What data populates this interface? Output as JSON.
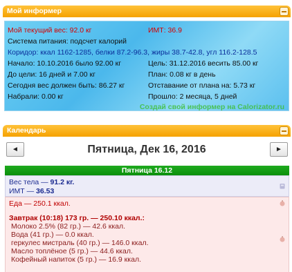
{
  "informer": {
    "header": "Мой информер",
    "rows": {
      "current_weight": "Мой текущий вес: 92.0 кг",
      "bmi": "ИМТ: 36.9",
      "system": "Система питания: подсчет калорий",
      "corridor": "Коридор: ккал 1162-1285, белки 87.2-96.3, жиры 38.7-42.8, угл 116.2-128.5",
      "start": "Начало: 10.10.2016 было 92.00 кг",
      "goal": "Цель: 31.12.2016 весить 85.00 кг",
      "to_goal": "До цели: 16 дней и 7.00 кг",
      "plan": "План: 0.08 кг в день",
      "should_weigh": "Сегодня вес должен быть: 86.27 кг",
      "lag": "Отставание от плана на: 5.73 кг",
      "gained": "Набрали: 0.00 кг",
      "elapsed": "Прошло: 2 месяца, 5 дней"
    },
    "watermark": "Создай свой информер на Calorizator.ru"
  },
  "calendar": {
    "header": "Календарь",
    "prev_label": "◄",
    "next_label": "►",
    "title": "Пятница, Дек 16, 2016",
    "day_bar": "Пятница 16.12",
    "weight": {
      "body_label": "Вес тела — ",
      "body_value": "91.2 кг.",
      "bmi_label": "ИМТ — ",
      "bmi_value": "36.53"
    },
    "food": {
      "total": "Еда — 250.1 ккал.",
      "meal": "Завтрак (10:18) 173 гр. — 250.10 ккал.:",
      "items": [
        "Молоко 2.5% (82 гр.) — 42.6 ккал.",
        "Вода (41 гр.) — 0.0 ккал.",
        "геркулес мистраль (40 гр.) — 146.0 ккал.",
        "Масло топлёное (5 гр.) — 44.6 ккал.",
        "Кофейный напиток (5 гр.) — 16.9 ккал."
      ]
    }
  }
}
